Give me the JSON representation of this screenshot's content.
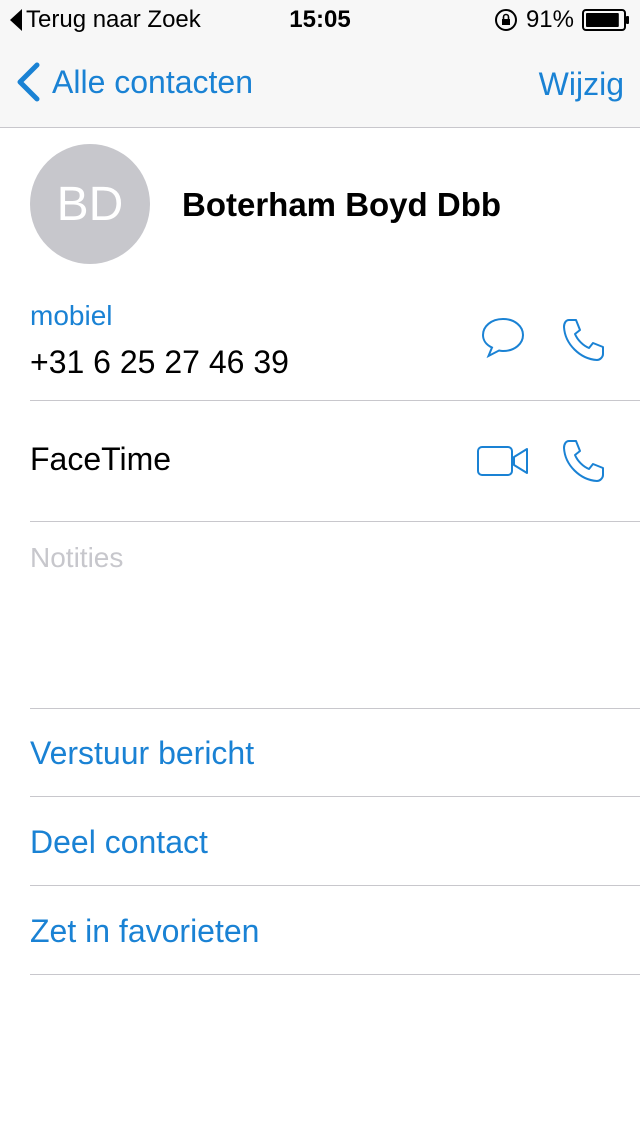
{
  "status_bar": {
    "back_app": "Terug naar Zoek",
    "time": "15:05",
    "battery_percent": "91%",
    "battery_level": 0.91,
    "icons": [
      "back-triangle-icon",
      "rotation-lock-icon",
      "battery-icon"
    ]
  },
  "nav": {
    "back_label": "Alle contacten",
    "edit_label": "Wijzig"
  },
  "contact": {
    "initials": "BD",
    "name": "Boterham Boyd Dbb"
  },
  "phone": {
    "label": "mobiel",
    "number": "+31 6 25 27 46 39"
  },
  "facetime": {
    "label": "FaceTime"
  },
  "notes": {
    "placeholder": "Notities"
  },
  "actions": [
    {
      "label": "Verstuur bericht"
    },
    {
      "label": "Deel contact"
    },
    {
      "label": "Zet in favorieten"
    }
  ],
  "colors": {
    "accent": "#1a82d4",
    "separator": "#c8c7cc",
    "avatar_bg": "#c7c7cc",
    "placeholder": "#c7c7cc"
  }
}
